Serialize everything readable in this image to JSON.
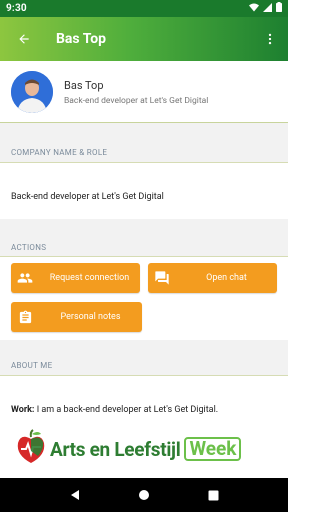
{
  "status_bar": {
    "time": "9:30"
  },
  "app_bar": {
    "title": "Bas Top"
  },
  "profile": {
    "name": "Bas Top",
    "role": "Back-end developer at Let's Get Digital"
  },
  "company_section": {
    "header": "COMPANY NAME & ROLE",
    "value": "Back-end developer at Let's Get Digital"
  },
  "actions_section": {
    "header": "ACTIONS",
    "request_connection": "Request connection",
    "open_chat": "Open chat",
    "personal_notes": "Personal notes"
  },
  "about_section": {
    "header": "ABOUT ME",
    "work_label": "Work:",
    "work_value": " I am a back-end developer at Let's Get Digital."
  },
  "banner": {
    "text": "Arts en Leefstijl",
    "week": "Week"
  },
  "colors": {
    "accent": "#f39c1f",
    "app_bar_start": "#8dc63f",
    "app_bar_end": "#1d8030"
  }
}
